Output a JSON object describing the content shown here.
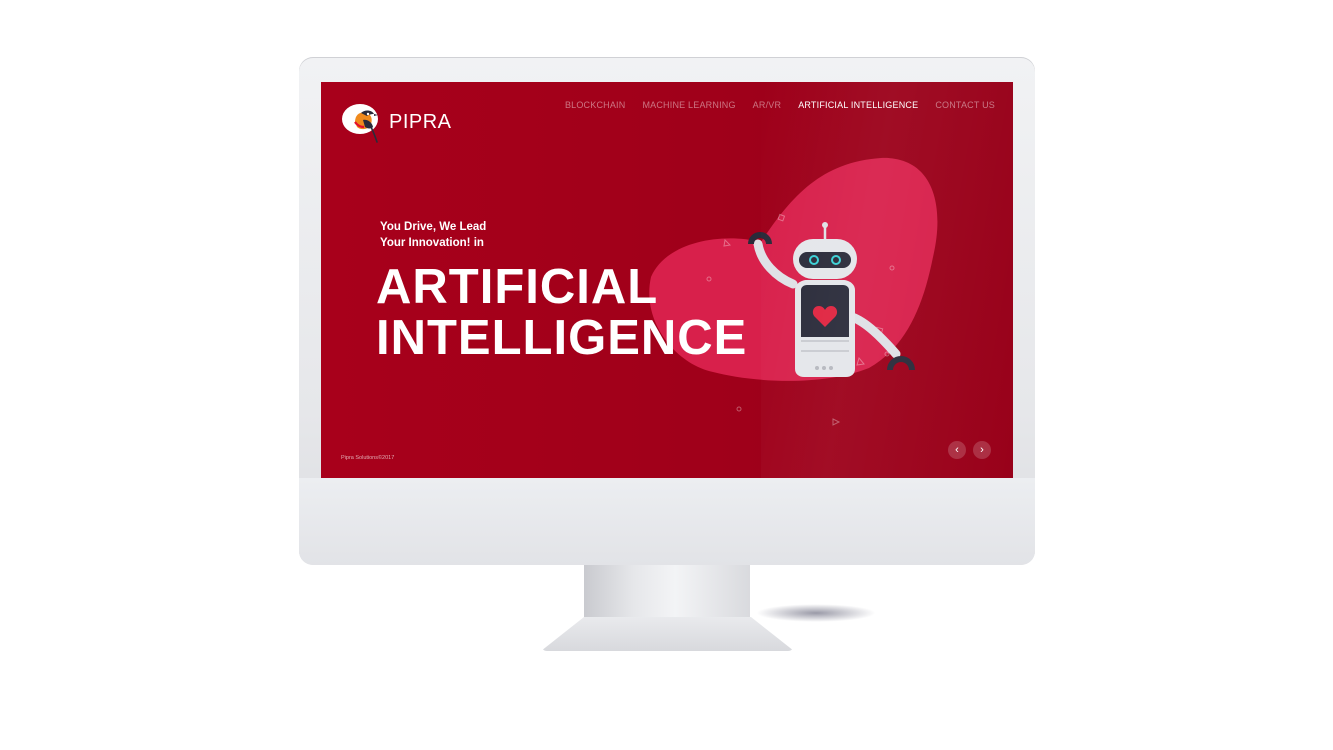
{
  "brand": {
    "name": "PIPRA",
    "accent": "#a8001b",
    "blob": "#d4204c"
  },
  "nav": {
    "items": [
      {
        "label": "BLOCKCHAIN",
        "active": false
      },
      {
        "label": "MACHINE LEARNING",
        "active": false
      },
      {
        "label": "AR/VR",
        "active": false
      },
      {
        "label": "ARTIFICIAL INTELLIGENCE",
        "active": true
      },
      {
        "label": "CONTACT US",
        "active": false
      }
    ]
  },
  "hero": {
    "tagline_line1": "You Drive, We Lead",
    "tagline_line2": "Your Innovation! in",
    "headline_line1": "ARTIFICIAL",
    "headline_line2": "INTELLIGENCE"
  },
  "footer": {
    "copyright": "Pipra Solutions©2017"
  },
  "slider": {
    "prev_icon": "chevron-left-icon",
    "next_icon": "chevron-right-icon",
    "prev_glyph": "‹",
    "next_glyph": "›"
  }
}
